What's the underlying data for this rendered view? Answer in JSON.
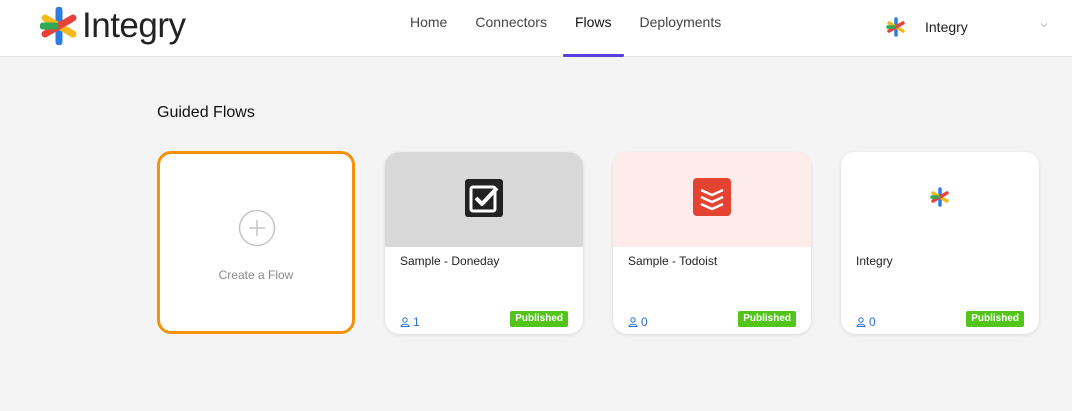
{
  "brand": {
    "name": "Integry"
  },
  "nav": {
    "items": [
      "Home",
      "Connectors",
      "Flows",
      "Deployments"
    ],
    "active": "Flows"
  },
  "account": {
    "name": "Integry"
  },
  "section": {
    "title": "Guided Flows"
  },
  "create": {
    "label": "Create a Flow"
  },
  "flows": [
    {
      "name": "Sample - Doneday",
      "runs": "1",
      "status": "Published",
      "header_color": "#d8d8d8",
      "icon": "doneday-checkbox-icon"
    },
    {
      "name": "Sample - Todoist",
      "runs": "0",
      "status": "Published",
      "header_color": "#fdecea",
      "icon": "todoist-icon"
    },
    {
      "name": "Integry",
      "runs": "0",
      "status": "Published",
      "header_color": "#ffffff",
      "icon": "integry-logo-icon"
    }
  ],
  "colors": {
    "accent": "#5b3ee0",
    "create_border": "#f5920a",
    "published": "#52c41a",
    "link": "#2a6fd6"
  }
}
